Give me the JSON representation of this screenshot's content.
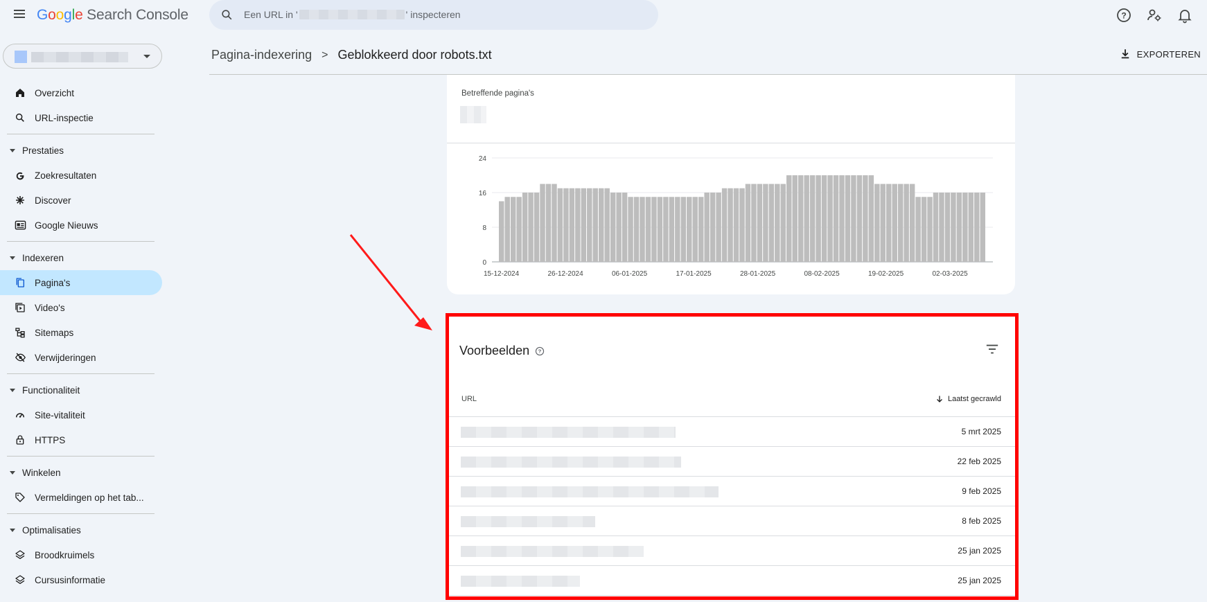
{
  "app": {
    "logo_letters": [
      "G",
      "o",
      "o",
      "g",
      "l",
      "e"
    ],
    "logo_rest": " Search Console"
  },
  "search": {
    "prefix": "Een URL in '",
    "suffix": "' inspecteren"
  },
  "top_icons": [
    "help-icon",
    "account-settings-icon",
    "notifications-icon"
  ],
  "sidebar": {
    "items": [
      {
        "type": "item",
        "label": "Overzicht",
        "icon": "home-icon"
      },
      {
        "type": "item",
        "label": "URL-inspectie",
        "icon": "search-icon"
      },
      {
        "type": "divider"
      },
      {
        "type": "section",
        "label": "Prestaties"
      },
      {
        "type": "item",
        "label": "Zoekresultaten",
        "icon": "google-g-icon"
      },
      {
        "type": "item",
        "label": "Discover",
        "icon": "asterisk-icon"
      },
      {
        "type": "item",
        "label": "Google Nieuws",
        "icon": "news-icon"
      },
      {
        "type": "divider"
      },
      {
        "type": "section",
        "label": "Indexeren"
      },
      {
        "type": "item",
        "label": "Pagina's",
        "icon": "pages-icon",
        "active": true
      },
      {
        "type": "item",
        "label": "Video's",
        "icon": "video-icon"
      },
      {
        "type": "item",
        "label": "Sitemaps",
        "icon": "sitemap-icon"
      },
      {
        "type": "item",
        "label": "Verwijderingen",
        "icon": "eye-off-icon"
      },
      {
        "type": "divider"
      },
      {
        "type": "section",
        "label": "Functionaliteit"
      },
      {
        "type": "item",
        "label": "Site-vitaliteit",
        "icon": "gauge-icon"
      },
      {
        "type": "item",
        "label": "HTTPS",
        "icon": "lock-icon"
      },
      {
        "type": "divider"
      },
      {
        "type": "section",
        "label": "Winkelen"
      },
      {
        "type": "item",
        "label": "Vermeldingen op het tab...",
        "icon": "tag-icon"
      },
      {
        "type": "divider"
      },
      {
        "type": "section",
        "label": "Optimalisaties"
      },
      {
        "type": "item",
        "label": "Broodkruimels",
        "icon": "layers-icon"
      },
      {
        "type": "item",
        "label": "Cursusinformatie",
        "icon": "layers-icon"
      }
    ]
  },
  "header": {
    "breadcrumb_parent": "Pagina-indexering",
    "breadcrumb_separator": ">",
    "breadcrumb_current": "Geblokkeerd door robots.txt",
    "export_label": "EXPORTEREN"
  },
  "chart": {
    "label": "Betreffende pagina's"
  },
  "chart_data": {
    "type": "bar",
    "ylim": [
      0,
      24
    ],
    "yticks": [
      "0",
      "8",
      "16",
      "24"
    ],
    "xtick_labels": [
      "15-12-2024",
      "26-12-2024",
      "06-01-2025",
      "17-01-2025",
      "28-01-2025",
      "08-02-2025",
      "19-02-2025",
      "02-03-2025"
    ],
    "grid": true,
    "values": [
      14,
      15,
      15,
      15,
      16,
      16,
      16,
      18,
      18,
      18,
      17,
      17,
      17,
      17,
      17,
      17,
      17,
      17,
      17,
      16,
      16,
      16,
      15,
      15,
      15,
      15,
      15,
      15,
      15,
      15,
      15,
      15,
      15,
      15,
      15,
      16,
      16,
      16,
      17,
      17,
      17,
      17,
      18,
      18,
      18,
      18,
      18,
      18,
      18,
      20,
      20,
      20,
      20,
      20,
      20,
      20,
      20,
      20,
      20,
      20,
      20,
      20,
      20,
      20,
      18,
      18,
      18,
      18,
      18,
      18,
      18,
      15,
      15,
      15,
      16,
      16,
      16,
      16,
      16,
      16,
      16,
      16,
      16
    ]
  },
  "examples": {
    "title": "Voorbeelden",
    "col_url": "URL",
    "col_crawled": "Laatst gecrawld",
    "rows": [
      {
        "date": "5 mrt 2025"
      },
      {
        "date": "22 feb 2025"
      },
      {
        "date": "9 feb 2025"
      },
      {
        "date": "8 feb 2025"
      },
      {
        "date": "25 jan 2025"
      },
      {
        "date": "25 jan 2025"
      }
    ]
  },
  "colors": {
    "bar": "#bdbdbd",
    "highlight": "#ff0000",
    "active_nav": "#c2e7ff"
  }
}
